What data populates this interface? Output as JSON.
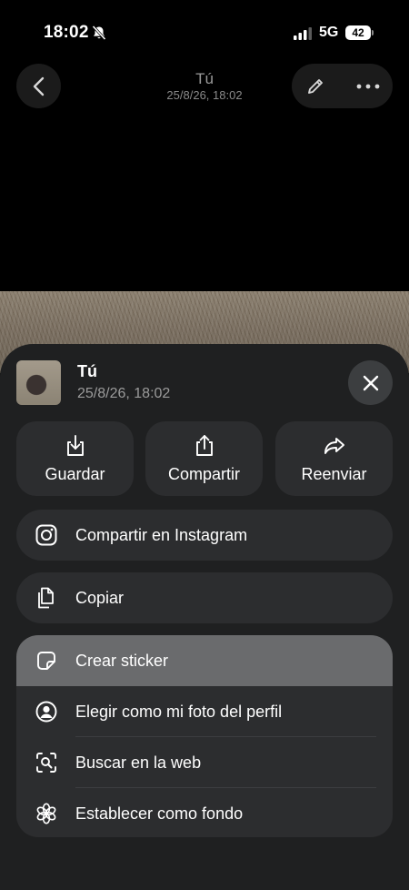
{
  "status": {
    "time": "18:02",
    "network": "5G",
    "battery": "42"
  },
  "header": {
    "title": "Tú",
    "subtitle": "25/8/26, 18:02"
  },
  "sheet": {
    "title": "Tú",
    "subtitle": "25/8/26, 18:02",
    "actions": [
      {
        "label": "Guardar",
        "icon": "download-icon"
      },
      {
        "label": "Compartir",
        "icon": "share-icon"
      },
      {
        "label": "Reenviar",
        "icon": "forward-icon"
      }
    ],
    "rows": [
      {
        "label": "Compartir en Instagram",
        "icon": "instagram-icon"
      },
      {
        "label": "Copiar",
        "icon": "copy-icon"
      }
    ],
    "group": [
      {
        "label": "Crear sticker",
        "icon": "sticker-icon",
        "highlighted": true
      },
      {
        "label": "Elegir como mi foto del perfil",
        "icon": "profile-icon"
      },
      {
        "label": "Buscar en la web",
        "icon": "visual-search-icon"
      },
      {
        "label": "Establecer como fondo",
        "icon": "flower-icon"
      }
    ]
  }
}
